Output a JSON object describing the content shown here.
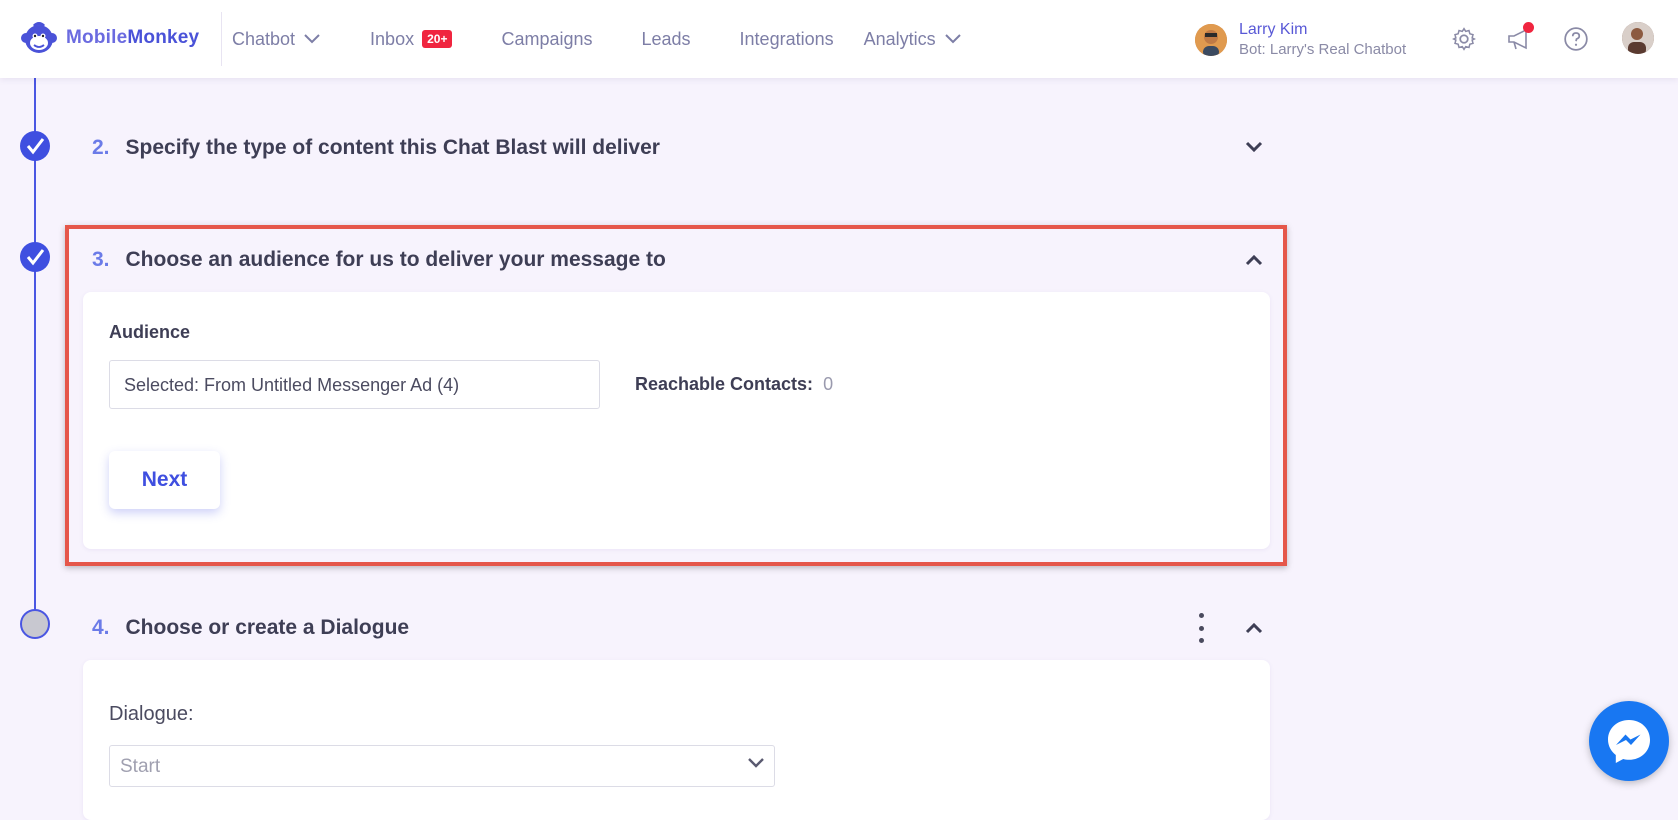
{
  "brand": {
    "name_part1": "Mobile",
    "name_part2": "Monkey",
    "logo_icon": "monkey-icon"
  },
  "nav": {
    "items": [
      {
        "label": "Chatbot",
        "has_dropdown": true
      },
      {
        "label": "Inbox",
        "badge": "20+"
      },
      {
        "label": "Campaigns"
      },
      {
        "label": "Leads"
      },
      {
        "label": "Integrations"
      },
      {
        "label": "Analytics",
        "has_dropdown": true
      }
    ]
  },
  "user": {
    "name": "Larry Kim",
    "bot": "Bot: Larry's Real Chatbot"
  },
  "icons": {
    "settings": "gear-icon",
    "announcements": "megaphone-icon",
    "help": "help-icon",
    "messenger": "messenger-icon"
  },
  "steps": [
    {
      "number": "2.",
      "title": "Specify the type of content this Chat Blast will deliver",
      "status": "done"
    },
    {
      "number": "3.",
      "title": "Choose an audience for us to deliver your message to",
      "status": "done"
    },
    {
      "number": "4.",
      "title": "Choose or create a Dialogue",
      "status": "pending"
    }
  ],
  "audience": {
    "label": "Audience",
    "selected": "Selected: From Untitled Messenger Ad (4)",
    "reachable_label": "Reachable Contacts:",
    "reachable_value": "0",
    "next_label": "Next"
  },
  "dialogue": {
    "label": "Dialogue:",
    "selected": "Start"
  },
  "colors": {
    "accent": "#3f4fe0",
    "badge": "#f0253f",
    "highlight": "#e5574a",
    "background": "#f7f3fd",
    "messenger": "#1877f2"
  }
}
